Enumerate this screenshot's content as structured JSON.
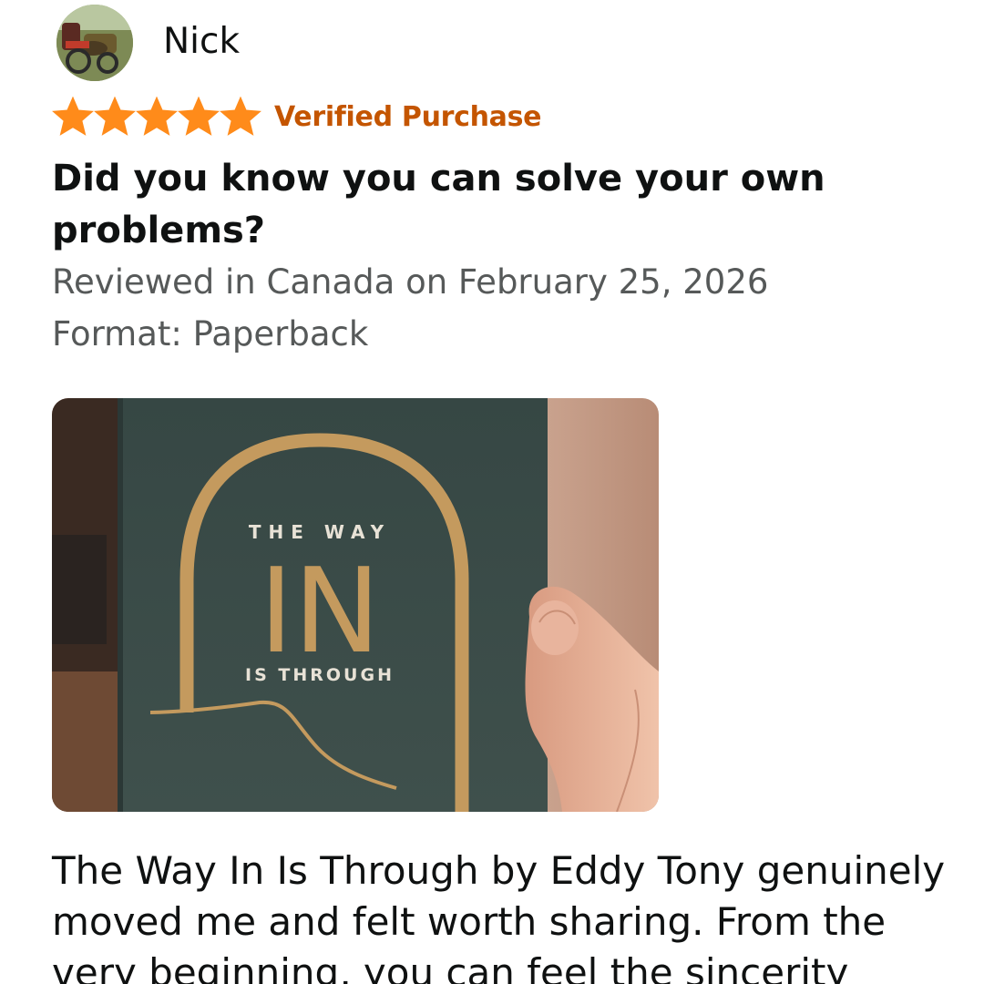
{
  "reviewer": {
    "name": "Nick",
    "avatar_icon": "reviewer-avatar-photo"
  },
  "rating": {
    "stars": 5,
    "max_stars": 5,
    "star_color": "#ff8b1a",
    "verified_label": "Verified Purchase",
    "verified_color": "#c45500"
  },
  "review": {
    "title": "Did you know you can solve your own problems?",
    "reviewed_in": "Reviewed in Canada on February 25, 2026",
    "format": "Format: Paperback",
    "body": "The Way In Is Through by Eddy Tony genuinely moved me and felt worth sharing. From the very beginning, you can feel the sincerity"
  },
  "photo": {
    "book_title_top": "THE WAY",
    "book_title_main": "IN",
    "book_title_bottom": "IS THROUGH",
    "cover_color": "#3b4b48",
    "accent_color": "#c49a5e"
  }
}
